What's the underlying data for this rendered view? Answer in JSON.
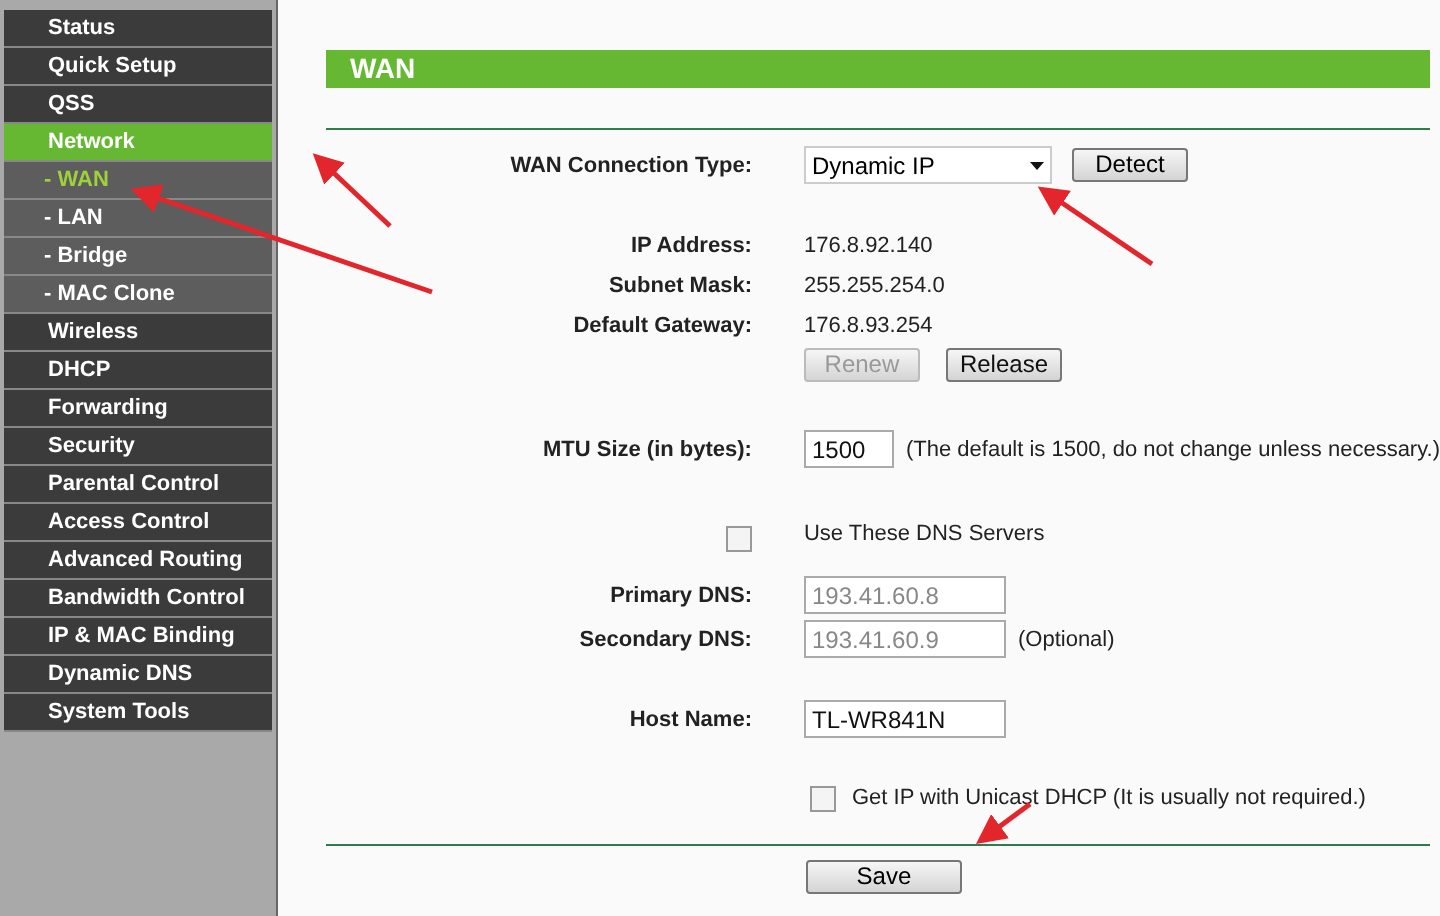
{
  "sidebar": {
    "items": [
      {
        "label": "Status",
        "selected": false
      },
      {
        "label": "Quick Setup",
        "selected": false
      },
      {
        "label": "QSS",
        "selected": false
      },
      {
        "label": "Network",
        "selected": true,
        "children": [
          {
            "label": "- WAN",
            "selected": true
          },
          {
            "label": "- LAN",
            "selected": false
          },
          {
            "label": "- Bridge",
            "selected": false
          },
          {
            "label": "- MAC Clone",
            "selected": false
          }
        ]
      },
      {
        "label": "Wireless",
        "selected": false
      },
      {
        "label": "DHCP",
        "selected": false
      },
      {
        "label": "Forwarding",
        "selected": false
      },
      {
        "label": "Security",
        "selected": false
      },
      {
        "label": "Parental Control",
        "selected": false
      },
      {
        "label": "Access Control",
        "selected": false
      },
      {
        "label": "Advanced Routing",
        "selected": false
      },
      {
        "label": "Bandwidth Control",
        "selected": false
      },
      {
        "label": "IP & MAC Binding",
        "selected": false
      },
      {
        "label": "Dynamic DNS",
        "selected": false
      },
      {
        "label": "System Tools",
        "selected": false
      }
    ]
  },
  "header": {
    "title": "WAN"
  },
  "connection_type": {
    "label": "WAN Connection Type:",
    "value": "Dynamic IP",
    "button": "Detect"
  },
  "status": [
    {
      "label": "IP Address:",
      "value": "176.8.92.140"
    },
    {
      "label": "Subnet Mask:",
      "value": "255.255.254.0"
    },
    {
      "label": "Default Gateway:",
      "value": "176.8.93.254"
    }
  ],
  "lease_buttons": [
    {
      "label": "Renew",
      "disabled": true
    },
    {
      "label": "Release",
      "disabled": false
    }
  ],
  "mtu": {
    "label": "MTU Size (in bytes):",
    "value": "1500",
    "note": "(The default is 1500, do not change unless necessary.)"
  },
  "dns": {
    "checkbox_label": "Use These DNS Servers",
    "checked": false,
    "primary": {
      "label": "Primary DNS:",
      "value": "193.41.60.8",
      "disabled": true
    },
    "secondary": {
      "label": "Secondary DNS:",
      "value": "193.41.60.9",
      "disabled": true,
      "note": "(Optional)"
    }
  },
  "host_name": {
    "label": "Host Name:",
    "value": "TL-WR841N"
  },
  "unicast": {
    "label": "Get IP with Unicast DHCP (It is usually not required.)",
    "checked": false
  },
  "save_button": "Save"
}
